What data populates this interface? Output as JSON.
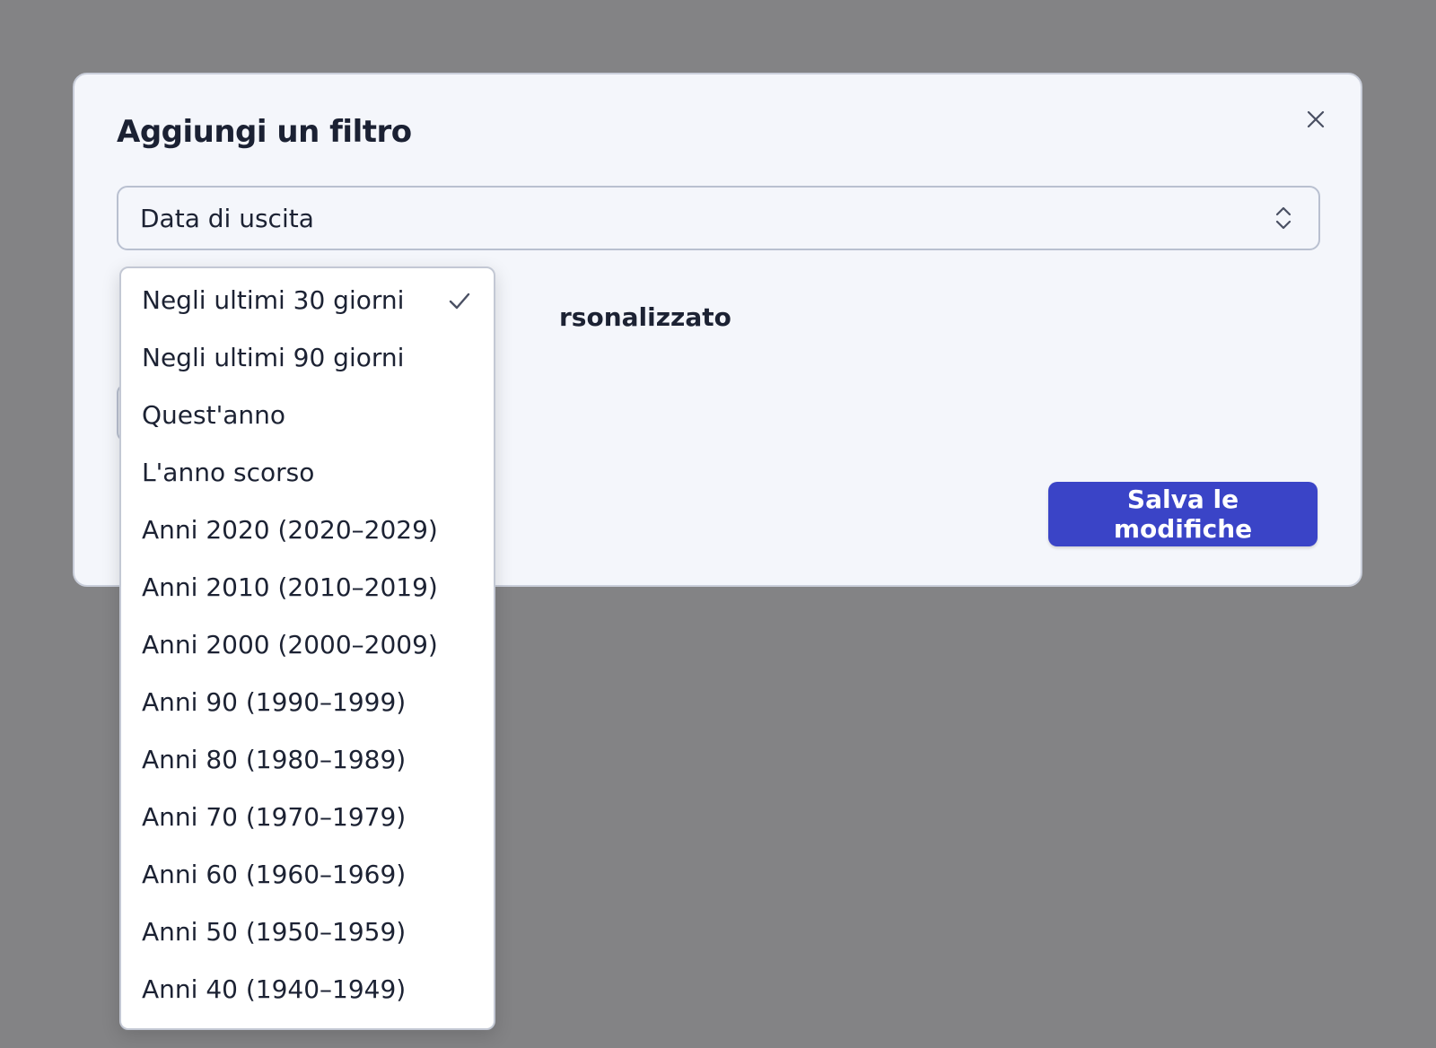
{
  "dialog": {
    "title": "Aggiungi un filtro",
    "close_icon": "close-icon"
  },
  "field_select": {
    "value": "Data di uscita",
    "icon": "chevron-up-down-icon"
  },
  "custom_option": {
    "label_visible": "rsonalizzato"
  },
  "save_button": {
    "label": "Salva le modifiche",
    "color": "#3a44c7"
  },
  "dropdown": {
    "selected_index": 0,
    "check_icon": "check-icon",
    "options": [
      "Negli ultimi 30 giorni",
      "Negli ultimi 90 giorni",
      "Quest'anno",
      "L'anno scorso",
      "Anni 2020 (2020–2029)",
      "Anni 2010 (2010–2019)",
      "Anni 2000 (2000–2009)",
      "Anni 90 (1990–1999)",
      "Anni 80 (1980–1989)",
      "Anni 70 (1970–1979)",
      "Anni 60 (1960–1969)",
      "Anni 50 (1950–1959)",
      "Anni 40 (1940–1949)"
    ]
  }
}
